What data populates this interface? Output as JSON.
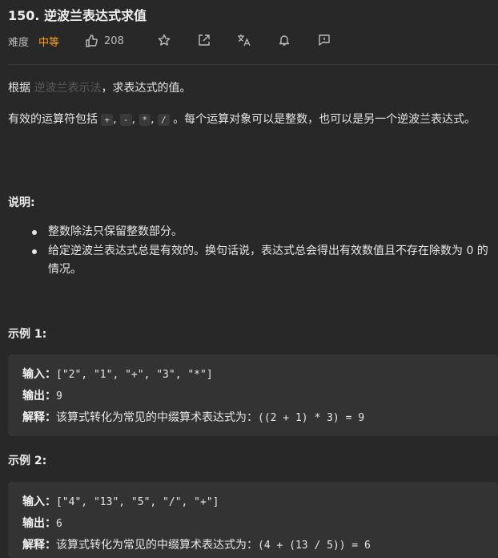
{
  "problem": {
    "title": "150. 逆波兰表达式求值",
    "difficulty_label": "难度",
    "difficulty_value": "中等",
    "likes": "208",
    "colors": {
      "difficulty": "#ffa116",
      "background": "#282828"
    },
    "icons": [
      "thumbs-up-icon",
      "star-icon",
      "share-icon",
      "translate-icon",
      "bell-icon",
      "feedback-icon"
    ]
  },
  "description": {
    "intro_prefix": "根据 ",
    "intro_link": "逆波兰表示法",
    "intro_suffix": "，求表达式的值。",
    "ops_prefix": "有效的运算符包括 ",
    "ops": [
      "+",
      "-",
      "*",
      "/"
    ],
    "ops_sep": ", ",
    "ops_suffix": " 。每个运算对象可以是整数，也可以是另一个逆波兰表达式。"
  },
  "notes": {
    "heading": "说明:",
    "items": [
      "整数除法只保留整数部分。",
      "给定逆波兰表达式总是有效的。换句话说，表达式总会得出有效数值且不存在除数为 0 的情况。"
    ]
  },
  "examples": [
    {
      "heading": "示例 1:",
      "input_label": "输入：",
      "input": "[\"2\", \"1\", \"+\", \"3\", \"*\"]",
      "output_label": "输出：",
      "output": "9",
      "explain_label": "解释：",
      "explain_text": "该算式转化为常见的中缀算术表达式为：",
      "explain_expr": "((2 + 1) * 3) = 9"
    },
    {
      "heading": "示例 2:",
      "input_label": "输入：",
      "input": "[\"4\", \"13\", \"5\", \"/\", \"+\"]",
      "output_label": "输出：",
      "output": "6",
      "explain_label": "解释：",
      "explain_text": "该算式转化为常见的中缀算术表达式为：",
      "explain_expr": "(4 + (13 / 5)) = 6"
    }
  ]
}
